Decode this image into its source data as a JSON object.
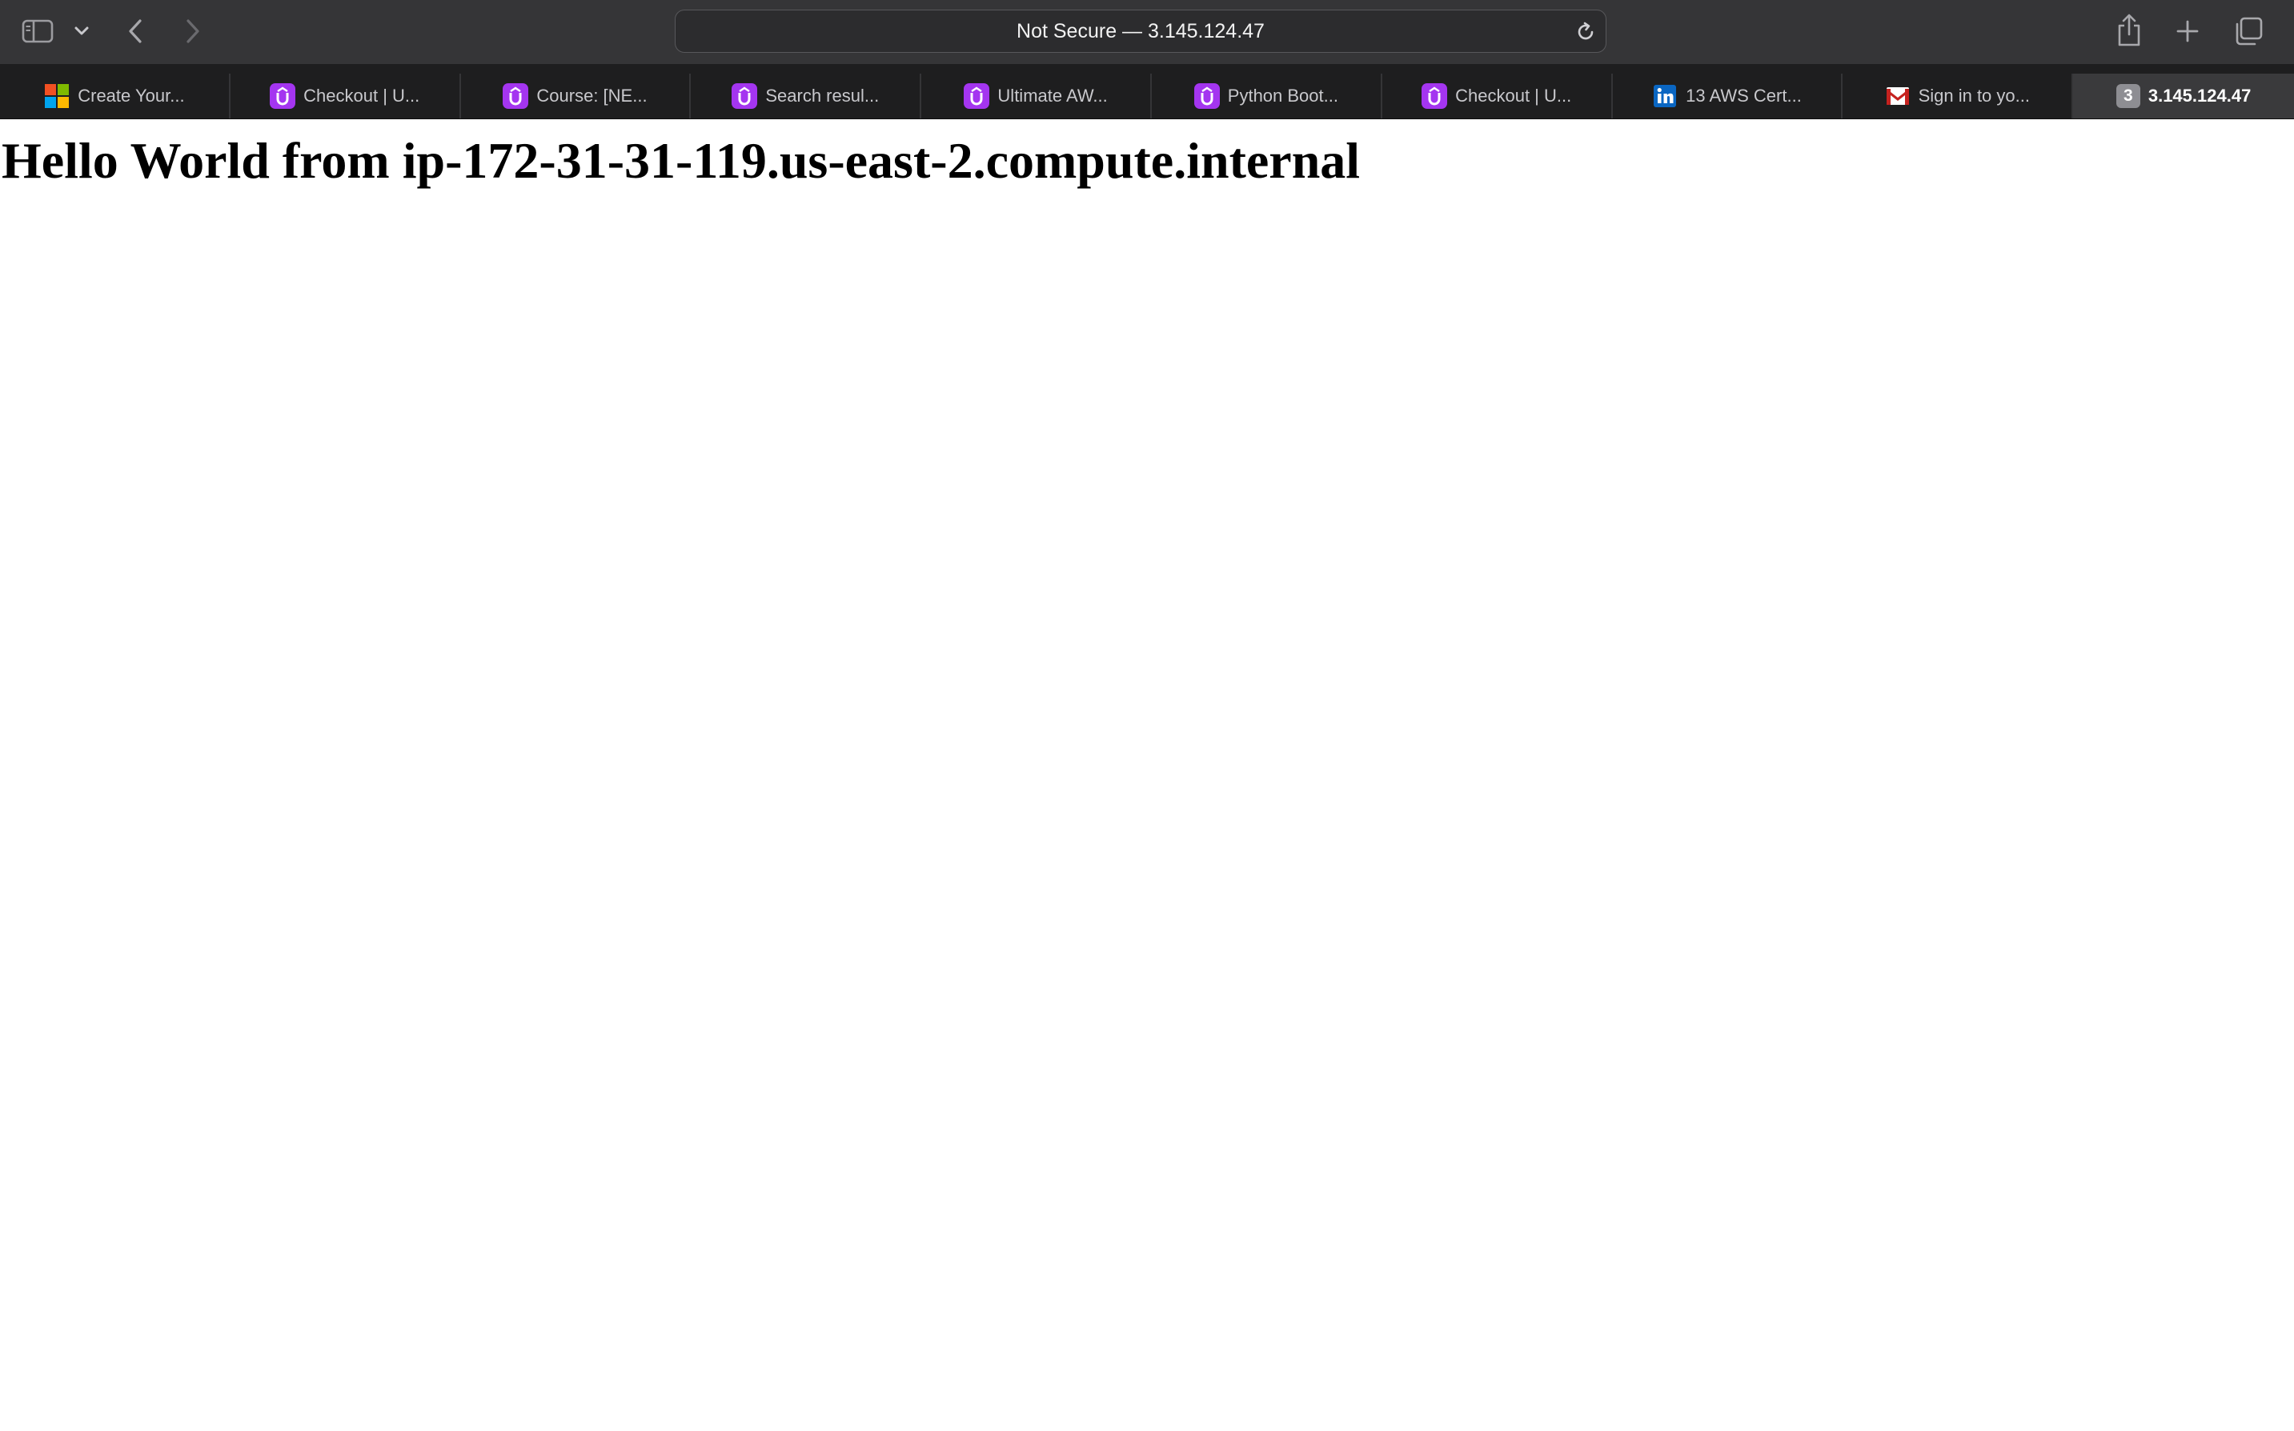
{
  "toolbar": {
    "address_text": "Not Secure — 3.145.124.47",
    "icons": [
      "sidebar-icon",
      "chevron-down-icon",
      "back-icon",
      "forward-icon",
      "reload-icon",
      "share-icon",
      "new-tab-icon",
      "tab-overview-icon"
    ]
  },
  "tabs": [
    {
      "label": "Create Your...",
      "favicon": "microsoft-icon"
    },
    {
      "label": "Checkout | U...",
      "favicon": "udemy-icon"
    },
    {
      "label": "Course: [NE...",
      "favicon": "udemy-icon"
    },
    {
      "label": "Search resul...",
      "favicon": "udemy-icon"
    },
    {
      "label": "Ultimate AW...",
      "favicon": "udemy-icon"
    },
    {
      "label": "Python Boot...",
      "favicon": "udemy-icon"
    },
    {
      "label": "Checkout | U...",
      "favicon": "udemy-icon"
    },
    {
      "label": "13 AWS Cert...",
      "favicon": "linkedin-icon"
    },
    {
      "label": "Sign in to yo...",
      "favicon": "gmail-icon"
    },
    {
      "label": "3.145.124.47",
      "favicon_letter": "3",
      "active": true
    }
  ],
  "page": {
    "heading": "Hello World from ip-172-31-31-119.us-east-2.compute.internal"
  },
  "colors": {
    "toolbar_bg": "#353537",
    "tabbar_bg": "#1e1e1f",
    "active_tab_bg": "#3a3a3c",
    "udemy_purple": "#a435f0",
    "linkedin_blue": "#0a66c2"
  }
}
